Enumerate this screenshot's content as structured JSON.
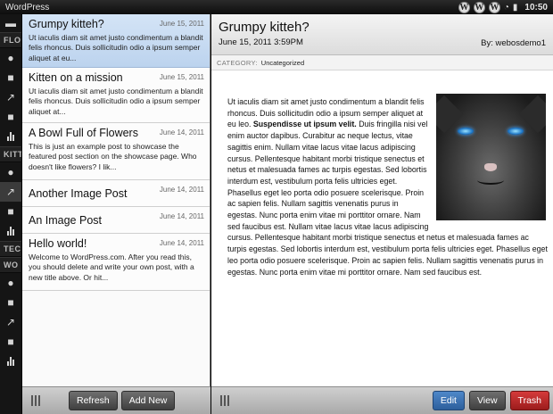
{
  "statusbar": {
    "app_title": "WordPress",
    "badge_letter": "W",
    "time": "10:50"
  },
  "sidebar": {
    "sections": [
      {
        "label": "FLO"
      },
      {
        "label": "KITTE"
      },
      {
        "label": "TEC"
      },
      {
        "label": "WO"
      }
    ],
    "icons": [
      "comments-icon",
      "pages-icon",
      "pin-icon",
      "pages-icon",
      "stats-icon"
    ]
  },
  "posts": [
    {
      "title": "Grumpy kitteh?",
      "date": "June 15, 2011",
      "excerpt": "Ut iaculis diam sit amet justo condimentum a blandit felis rhoncus. Duis sollicitudin odio a ipsum semper aliquet at eu..."
    },
    {
      "title": "Kitten on a mission",
      "date": "June 15, 2011",
      "excerpt": "Ut iaculis diam sit amet justo condimentum a blandit felis rhoncus. Duis sollicitudin odio a ipsum semper aliquet at..."
    },
    {
      "title": "A Bowl Full of Flowers",
      "date": "June 14, 2011",
      "excerpt": "This is just an example post to showcase the featured post section on the showcase page. Who doesn't like flowers? I lik..."
    },
    {
      "title": "Another Image Post",
      "date": "June 14, 2011",
      "excerpt": ""
    },
    {
      "title": "An Image Post",
      "date": "June 14, 2011",
      "excerpt": ""
    },
    {
      "title": "Hello world!",
      "date": "June 14, 2011",
      "excerpt": "Welcome to WordPress.com. After you read this, you should delete and write your own post, with a new title above. Or hit..."
    }
  ],
  "list_toolbar": {
    "refresh_label": "Refresh",
    "add_new_label": "Add New"
  },
  "detail": {
    "title": "Grumpy kitteh?",
    "datetime": "June 15, 2011 3:59PM",
    "author": "By: webosdemo1",
    "category_label": "CATEGORY:",
    "category_value": "Uncategorized",
    "body_intro": "Ut iaculis diam sit amet justo condimentum a blandit felis rhoncus. Duis sollicitudin odio a ipsum semper aliquet at eu leo.",
    "body_bold": "Suspendisse ut ipsum velit.",
    "body_rest": "Duis fringilla nisi vel enim auctor dapibus. Curabitur ac neque lectus, vitae sagittis enim. Nullam vitae lacus vitae lacus adipiscing cursus. Pellentesque habitant morbi tristique senectus et netus et malesuada fames ac turpis egestas. Sed lobortis interdum est, vestibulum porta felis ultricies eget. Phasellus eget leo porta odio posuere scelerisque. Proin ac sapien felis. Nullam sagittis venenatis purus in egestas. Nunc porta enim vitae mi porttitor ornare. Nam sed faucibus est. Nullam vitae lacus vitae lacus adipiscing cursus. Pellentesque habitant morbi tristique senectus et netus et malesuada fames ac turpis egestas. Sed lobortis interdum est, vestibulum porta felis ultricies eget. Phasellus eget leo porta odio posuere scelerisque. Proin ac sapien felis. Nullam sagittis venenatis purus in egestas. Nunc porta enim vitae mi porttitor ornare. Nam sed faucibus est.",
    "image_icon": "grumpy-cat-photo"
  },
  "detail_toolbar": {
    "edit_label": "Edit",
    "view_label": "View",
    "trash_label": "Trash"
  },
  "colors": {
    "selected_row": "#c9dcf2",
    "edit_button": "#3c72b4",
    "trash_button": "#c02a2a"
  }
}
